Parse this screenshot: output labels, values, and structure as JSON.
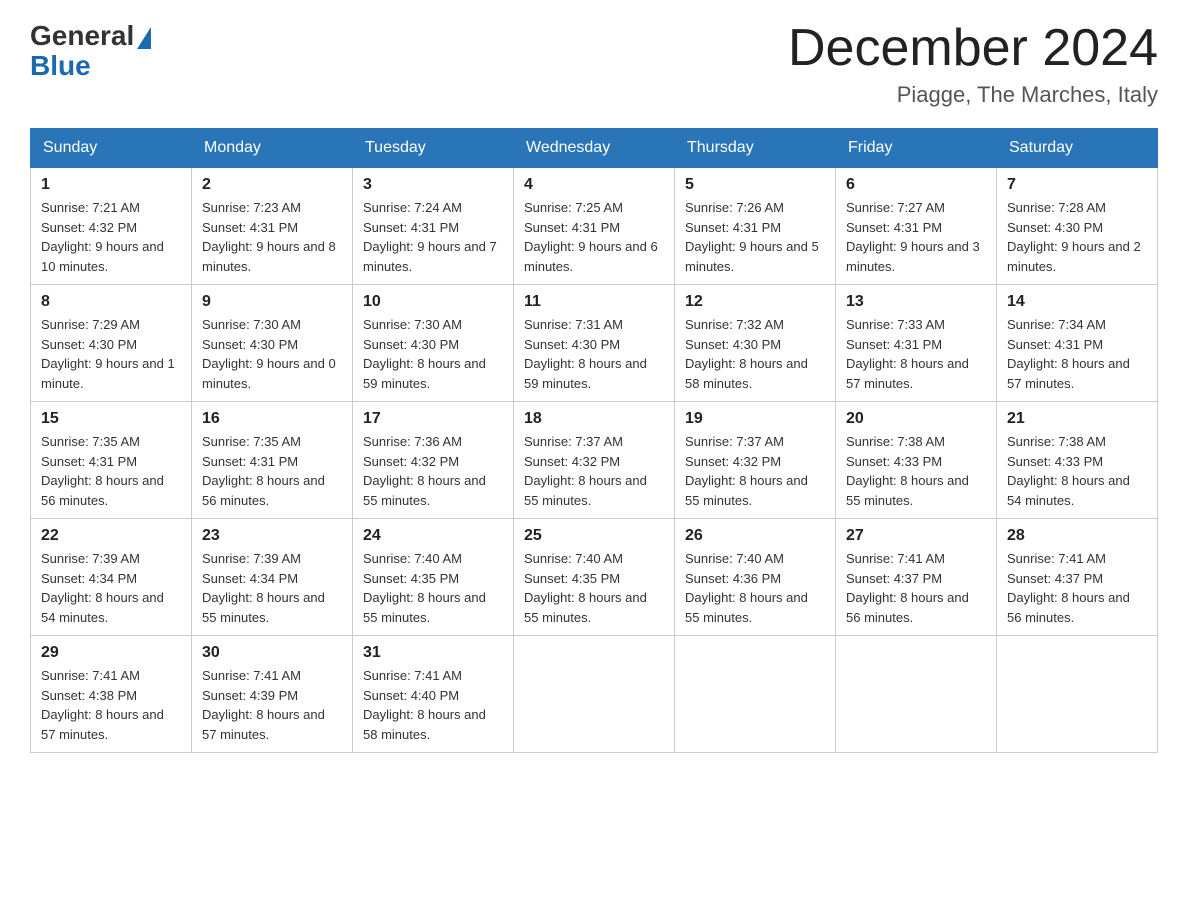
{
  "header": {
    "logo_general": "General",
    "logo_blue": "Blue",
    "month_title": "December 2024",
    "location": "Piagge, The Marches, Italy"
  },
  "days_of_week": [
    "Sunday",
    "Monday",
    "Tuesday",
    "Wednesday",
    "Thursday",
    "Friday",
    "Saturday"
  ],
  "weeks": [
    [
      {
        "day": "1",
        "sunrise": "7:21 AM",
        "sunset": "4:32 PM",
        "daylight": "9 hours and 10 minutes."
      },
      {
        "day": "2",
        "sunrise": "7:23 AM",
        "sunset": "4:31 PM",
        "daylight": "9 hours and 8 minutes."
      },
      {
        "day": "3",
        "sunrise": "7:24 AM",
        "sunset": "4:31 PM",
        "daylight": "9 hours and 7 minutes."
      },
      {
        "day": "4",
        "sunrise": "7:25 AM",
        "sunset": "4:31 PM",
        "daylight": "9 hours and 6 minutes."
      },
      {
        "day": "5",
        "sunrise": "7:26 AM",
        "sunset": "4:31 PM",
        "daylight": "9 hours and 5 minutes."
      },
      {
        "day": "6",
        "sunrise": "7:27 AM",
        "sunset": "4:31 PM",
        "daylight": "9 hours and 3 minutes."
      },
      {
        "day": "7",
        "sunrise": "7:28 AM",
        "sunset": "4:30 PM",
        "daylight": "9 hours and 2 minutes."
      }
    ],
    [
      {
        "day": "8",
        "sunrise": "7:29 AM",
        "sunset": "4:30 PM",
        "daylight": "9 hours and 1 minute."
      },
      {
        "day": "9",
        "sunrise": "7:30 AM",
        "sunset": "4:30 PM",
        "daylight": "9 hours and 0 minutes."
      },
      {
        "day": "10",
        "sunrise": "7:30 AM",
        "sunset": "4:30 PM",
        "daylight": "8 hours and 59 minutes."
      },
      {
        "day": "11",
        "sunrise": "7:31 AM",
        "sunset": "4:30 PM",
        "daylight": "8 hours and 59 minutes."
      },
      {
        "day": "12",
        "sunrise": "7:32 AM",
        "sunset": "4:30 PM",
        "daylight": "8 hours and 58 minutes."
      },
      {
        "day": "13",
        "sunrise": "7:33 AM",
        "sunset": "4:31 PM",
        "daylight": "8 hours and 57 minutes."
      },
      {
        "day": "14",
        "sunrise": "7:34 AM",
        "sunset": "4:31 PM",
        "daylight": "8 hours and 57 minutes."
      }
    ],
    [
      {
        "day": "15",
        "sunrise": "7:35 AM",
        "sunset": "4:31 PM",
        "daylight": "8 hours and 56 minutes."
      },
      {
        "day": "16",
        "sunrise": "7:35 AM",
        "sunset": "4:31 PM",
        "daylight": "8 hours and 56 minutes."
      },
      {
        "day": "17",
        "sunrise": "7:36 AM",
        "sunset": "4:32 PM",
        "daylight": "8 hours and 55 minutes."
      },
      {
        "day": "18",
        "sunrise": "7:37 AM",
        "sunset": "4:32 PM",
        "daylight": "8 hours and 55 minutes."
      },
      {
        "day": "19",
        "sunrise": "7:37 AM",
        "sunset": "4:32 PM",
        "daylight": "8 hours and 55 minutes."
      },
      {
        "day": "20",
        "sunrise": "7:38 AM",
        "sunset": "4:33 PM",
        "daylight": "8 hours and 55 minutes."
      },
      {
        "day": "21",
        "sunrise": "7:38 AM",
        "sunset": "4:33 PM",
        "daylight": "8 hours and 54 minutes."
      }
    ],
    [
      {
        "day": "22",
        "sunrise": "7:39 AM",
        "sunset": "4:34 PM",
        "daylight": "8 hours and 54 minutes."
      },
      {
        "day": "23",
        "sunrise": "7:39 AM",
        "sunset": "4:34 PM",
        "daylight": "8 hours and 55 minutes."
      },
      {
        "day": "24",
        "sunrise": "7:40 AM",
        "sunset": "4:35 PM",
        "daylight": "8 hours and 55 minutes."
      },
      {
        "day": "25",
        "sunrise": "7:40 AM",
        "sunset": "4:35 PM",
        "daylight": "8 hours and 55 minutes."
      },
      {
        "day": "26",
        "sunrise": "7:40 AM",
        "sunset": "4:36 PM",
        "daylight": "8 hours and 55 minutes."
      },
      {
        "day": "27",
        "sunrise": "7:41 AM",
        "sunset": "4:37 PM",
        "daylight": "8 hours and 56 minutes."
      },
      {
        "day": "28",
        "sunrise": "7:41 AM",
        "sunset": "4:37 PM",
        "daylight": "8 hours and 56 minutes."
      }
    ],
    [
      {
        "day": "29",
        "sunrise": "7:41 AM",
        "sunset": "4:38 PM",
        "daylight": "8 hours and 57 minutes."
      },
      {
        "day": "30",
        "sunrise": "7:41 AM",
        "sunset": "4:39 PM",
        "daylight": "8 hours and 57 minutes."
      },
      {
        "day": "31",
        "sunrise": "7:41 AM",
        "sunset": "4:40 PM",
        "daylight": "8 hours and 58 minutes."
      },
      null,
      null,
      null,
      null
    ]
  ]
}
